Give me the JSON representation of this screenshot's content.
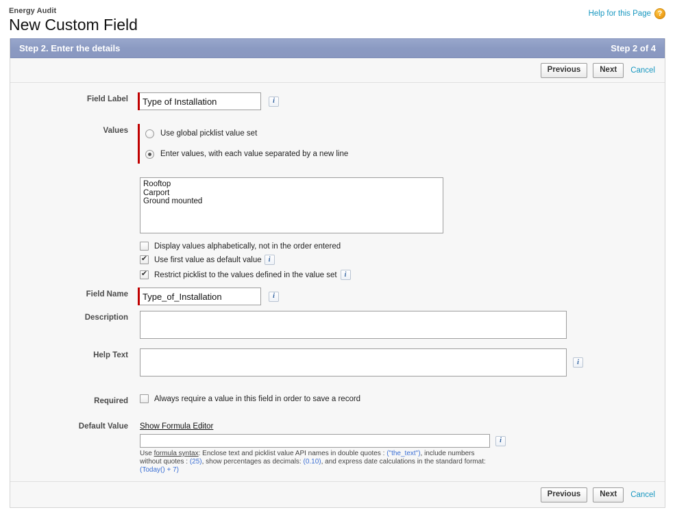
{
  "header": {
    "breadcrumb": "Energy Audit",
    "title": "New Custom Field",
    "help_link": "Help for this Page",
    "help_icon": "question-mark-icon"
  },
  "step": {
    "title": "Step 2. Enter the details",
    "counter": "Step 2 of 4"
  },
  "buttons": {
    "previous": "Previous",
    "next": "Next",
    "cancel": "Cancel"
  },
  "form": {
    "field_label": {
      "label": "Field Label",
      "value": "Type of Installation",
      "placeholder": ""
    },
    "values": {
      "label": "Values",
      "option_global": "Use global picklist value set",
      "option_enter": "Enter values, with each value separated by a new line",
      "selected": "enter",
      "textarea_value": "Rooftop\nCarport\nGround mounted",
      "checkbox_alphabetical": "Display values alphabetically, not in the order entered",
      "checkbox_alphabetical_checked": false,
      "checkbox_first_default": "Use first value as default value",
      "checkbox_first_default_checked": true,
      "checkbox_restrict": "Restrict picklist to the values defined in the value set",
      "checkbox_restrict_checked": true
    },
    "field_name": {
      "label": "Field Name",
      "value": "Type_of_Installation"
    },
    "description": {
      "label": "Description",
      "value": ""
    },
    "help_text": {
      "label": "Help Text",
      "value": ""
    },
    "required": {
      "label": "Required",
      "checkbox_label": "Always require a value in this field in order to save a record",
      "checked": false
    },
    "default_value": {
      "label": "Default Value",
      "formula_editor_link": "Show Formula Editor",
      "value": "",
      "help_prefix": "Use ",
      "help_syntax_link": "formula syntax",
      "help_part1": ": Enclose text and picklist value API names in double quotes : ",
      "help_code1": "(\"the_text\")",
      "help_part2": ", include numbers without quotes : ",
      "help_code2": "(25)",
      "help_part3": ", show percentages as decimals: ",
      "help_code3": "(0.10)",
      "help_part4": ", and express date calculations in the standard format: ",
      "help_code4": "(Today() + 7)"
    }
  },
  "colors": {
    "step_header_bg": "#8d9cc4",
    "required_bar": "#c00000",
    "link": "#1797c0",
    "code_text": "#3b6fd4",
    "help_icon": "#f0a21b"
  },
  "icons": {
    "info": "i"
  }
}
